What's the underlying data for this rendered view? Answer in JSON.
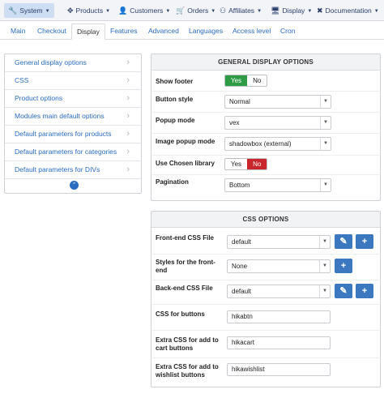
{
  "menu": {
    "items": [
      {
        "label": "System",
        "icon": "wrench-icon",
        "glyph": "🔧",
        "active": true
      },
      {
        "label": "Products",
        "icon": "cubes-icon",
        "glyph": "✥"
      },
      {
        "label": "Customers",
        "icon": "user-icon",
        "glyph": "👤"
      },
      {
        "label": "Orders",
        "icon": "cart-icon",
        "glyph": "🛒"
      },
      {
        "label": "Affiliates",
        "icon": "affiliates-icon",
        "glyph": "⚇"
      },
      {
        "label": "Display",
        "icon": "monitor-icon",
        "glyph": "🖥"
      },
      {
        "label": "Documentation",
        "icon": "help-icon",
        "glyph": "✖"
      }
    ]
  },
  "tabs": [
    "Main",
    "Checkout",
    "Display",
    "Features",
    "Advanced",
    "Languages",
    "Access level",
    "Cron"
  ],
  "active_tab": "Display",
  "sidebar": {
    "items": [
      "General display options",
      "CSS",
      "Product options",
      "Modules main default options",
      "Default parameters for products",
      "Default parameters for categories",
      "Default parameters for DIVs"
    ],
    "chevron": "›",
    "collapse_glyph": "⌃"
  },
  "general": {
    "title": "GENERAL DISPLAY OPTIONS",
    "show_footer": {
      "label": "Show footer",
      "yes": "Yes",
      "no": "No",
      "value": "Yes"
    },
    "button_style": {
      "label": "Button style",
      "value": "Normal"
    },
    "popup_mode": {
      "label": "Popup mode",
      "value": "vex"
    },
    "image_popup_mode": {
      "label": "Image popup mode",
      "value": "shadowbox (external)"
    },
    "use_chosen": {
      "label": "Use Chosen library",
      "yes": "Yes",
      "no": "No",
      "value": "No"
    },
    "pagination": {
      "label": "Pagination",
      "value": "Bottom"
    }
  },
  "css": {
    "title": "CSS OPTIONS",
    "frontend_css": {
      "label": "Front-end CSS File",
      "value": "default"
    },
    "styles_frontend": {
      "label": "Styles for the front-end",
      "value": "None"
    },
    "backend_css": {
      "label": "Back-end CSS File",
      "value": "default"
    },
    "css_buttons": {
      "label": "CSS for buttons",
      "value": "hikabtn"
    },
    "extra_cart": {
      "label": "Extra CSS for add to cart buttons",
      "value": "hikacart"
    },
    "extra_wishlist": {
      "label": "Extra CSS for add to wishlist buttons",
      "value": "hikawishlist"
    }
  },
  "glyphs": {
    "caret": "▼",
    "edit": "✎",
    "add": "+"
  },
  "colors": {
    "accent": "#3b78c0",
    "yes_green": "#2e9b46",
    "no_red": "#c8262a",
    "link": "#2a6cbf"
  }
}
